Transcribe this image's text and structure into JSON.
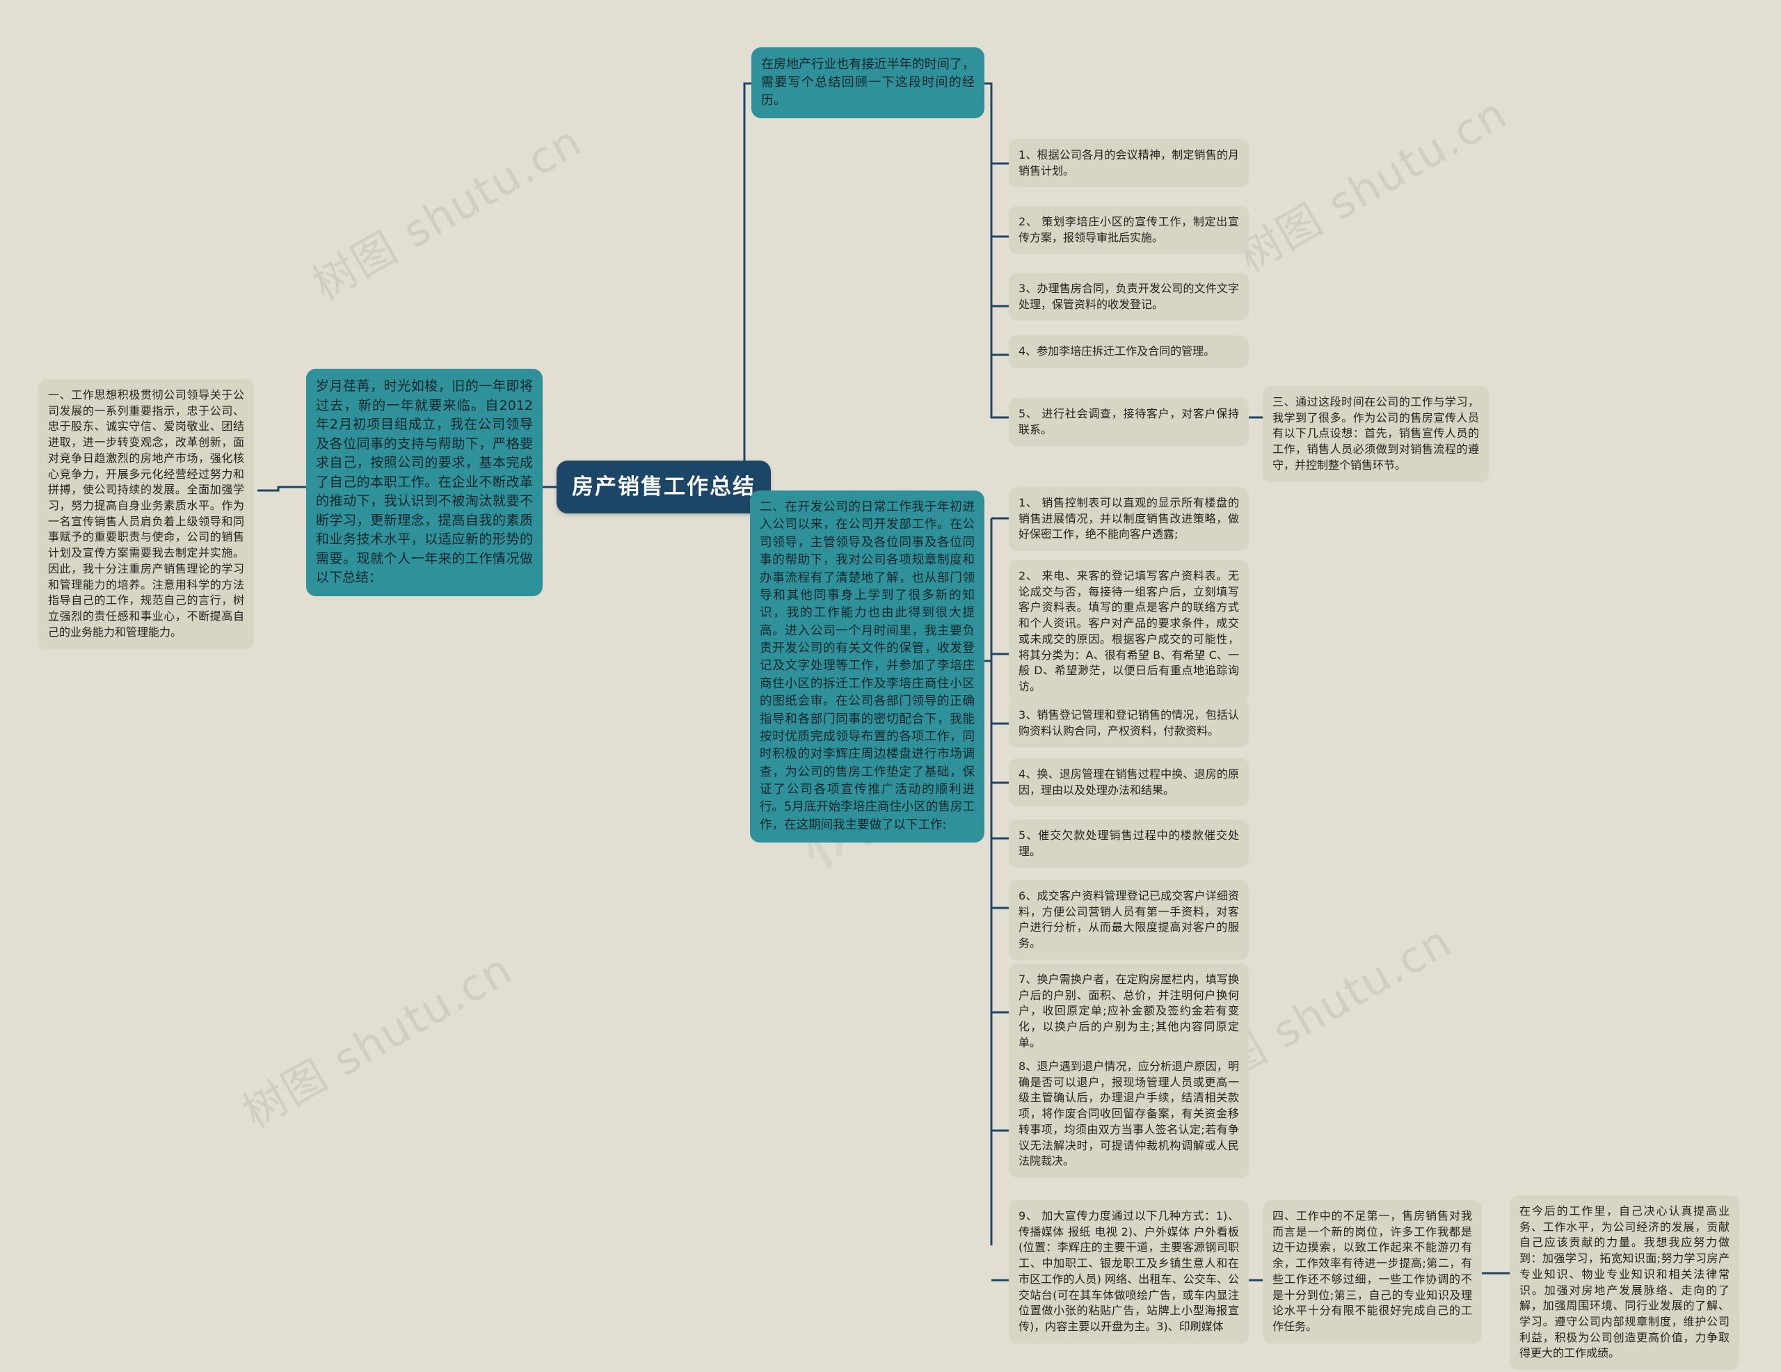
{
  "theme": {
    "canvas_bg": "#e2dfd2",
    "root_bg": "#1c4668",
    "root_fg": "#ffffff",
    "teal_bg": "#2f9199",
    "beige_bg": "#d7d5c4",
    "line_color": "#1c4668",
    "watermark_text": "树图 shutu.cn"
  },
  "root": {
    "title": "房产销售工作总结"
  },
  "branches": {
    "intro_left": "一、工作思想积极贯彻公司领导关于公司发展的一系列重要指示，忠于公司、忠于股东、诚实守信、爱岗敬业、团结进取，进一步转变观念，改革创新，面对竞争日趋激烈的房地产市场，强化核心竞争力，开展多元化经营经过努力和拼搏，使公司持续的发展。全面加强学习，努力提高自身业务素质水平。作为一名宣传销售人员肩负着上级领导和同事赋予的重要职责与使命，公司的销售计划及宣传方案需要我去制定并实施。因此，我十分注重房产销售理论的学习和管理能力的培养。注意用科学的方法指导自己的工作，规范自己的言行，树立强烈的责任感和事业心，不断提高自己的业务能力和管理能力。",
    "intro_teal": "岁月荏苒，时光如梭，旧的一年即将过去，新的一年就要来临。自2012年2月初项目组成立，我在公司领导及各位同事的支持与帮助下，严格要求自己，按照公司的要求，基本完成了自己的本职工作。在企业不断改革的推动下，我认识到不被淘汰就要不断学习，更新理念，提高自我的素质和业务技术水平，以适应新的形势的需要。现就个人一年来的工作情况做以下总结：",
    "top_teal": "在房地产行业也有接近半年的时间了，需要写个总结回顾一下这段时间的经历。",
    "section_two": "二、在开发公司的日常工作我于年初进入公司以来，在公司开发部工作。在公司领导，主管领导及各位同事及各位同事的帮助下，我对公司各项规章制度和办事流程有了清楚地了解，也从部门领导和其他同事身上学到了很多新的知识，我的工作能力也由此得到很大提高。进入公司一个月时间里，我主要负责开发公司的有关文件的保管，收发登记及文字处理等工作，并参加了李培庄商住小区的拆迁工作及李培庄商住小区的图纸会审。在公司各部门领导的正确指导和各部门同事的密切配合下，我能按时优质完成领导布置的各项工作，同时积极的对李辉庄周边楼盘进行市场调查，为公司的售房工作垫定了基础，保证了公司各项宣传推广活动的顺利进行。5月底开始李培庄商住小区的售房工作，在这期间我主要做了以下工作:",
    "section_three": "三、通过这段时间在公司的工作与学习，我学到了很多。作为公司的售房宣传人员有以下几点设想：首先，销售宣传人员的工作，销售人员必须做到对销售流程的遵守，并控制整个销售环节。",
    "section_four": "四、工作中的不足第一，售房销售对我而言是一个新的岗位，许多工作我都是边干边摸索，以致工作起来不能游刃有余，工作效率有待进一步提高;第二，有些工作还不够过细，一些工作协调的不是十分到位;第三，自己的专业知识及理论水平十分有限不能很好完成自己的工作任务。",
    "outlook": "在今后的工作里，自己决心认真提高业务、工作水平，为公司经济的发展，贡献自己应该贡献的力量。我想我应努力做到：加强学习，拓宽知识面;努力学习房产专业知识、物业专业知识和相关法律常识。加强对房地产发展脉络、走向的了解，加强周围环境、同行业发展的了解、学习。遵守公司内部规章制度，维护公司利益，积极为公司创造更高价值，力争取得更大的工作成绩。"
  },
  "top_items": [
    "1、根据公司各月的会议精神，制定销售的月销售计划。",
    "2、 策划李培庄小区的宣传工作，制定出宣传方案，报领导审批后实施。",
    "3、办理售房合同，负责开发公司的文件文字处理，保管资料的收发登记。",
    "4、参加李培庄拆迁工作及合同的管理。",
    "5、 进行社会调查，接待客户，对客户保持联系。"
  ],
  "detail_items": [
    "1、 销售控制表可以直观的显示所有楼盘的销售进展情况，并以制度销售改进策略，做好保密工作，绝不能向客户透露;",
    "2、 来电、来客的登记填写客户资料表。无论成交与否，每接待一组客户后，立刻填写客户资料表。填写的重点是客户的联络方式和个人资讯。客户对产品的要求条件，成交或未成交的原因。根据客户成交的可能性，将其分类为：A、很有希望 B、有希望 C、一般 D、希望渺茫，以便日后有重点地追踪询访。",
    "3、销售登记管理和登记销售的情况，包括认购资料认购合同，产权资料，付款资料。",
    "4、换、退房管理在销售过程中换、退房的原因，理由以及处理办法和结果。",
    "5、催交欠款处理销售过程中的楼款催交处理。",
    "6、成交客户资料管理登记已成交客户详细资料，方便公司营销人员有第一手资料，对客户进行分析，从而最大限度提高对客户的服务。",
    "7、换户需换户者，在定购房屋栏内，填写换户后的户别、面积、总价，并注明何户换何户，收回原定单;应补金额及签约金若有变化，以换户后的户别为主;其他内容同原定单。",
    "8、退户遇到退户情况，应分析退户原因，明确是否可以退户，报现场管理人员或更高一级主管确认后，办理退户手续，结清相关款项，将作废合同收回留存备案，有关资金移转事项，均须由双方当事人签名认定;若有争议无法解决时，可提请仲裁机构调解或人民法院裁决。",
    "9、 加大宣传力度通过以下几种方式：1)、传播媒体 报纸 电视 2)、户外媒体 户外看板(位置：李辉庄的主要干道，主要客源钢司职工、中加职工、银龙职工及乡镇生意人和在市区工作的人员) 网络、出租车、公交车、公交站台(可在其车体做喷绘广告，或车内显注位置做小张的粘贴广告，站牌上小型海报宣传)，内容主要以开盘为主。3)、印刷媒体"
  ]
}
